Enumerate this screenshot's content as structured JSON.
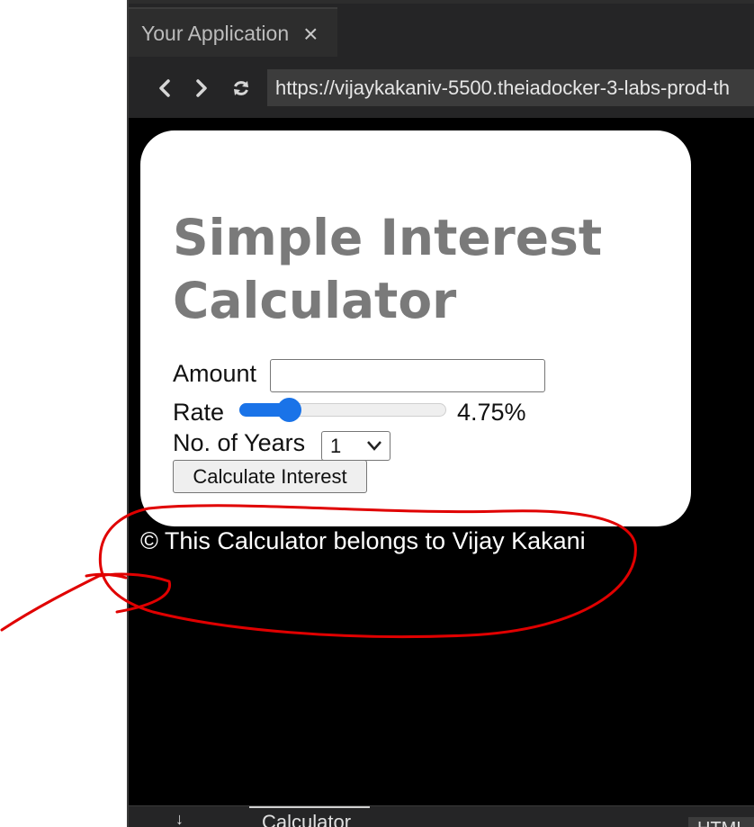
{
  "window": {
    "tab_title": "Your Application",
    "tab_close": "×",
    "url": "https://vijaykakaniv-5500.theiadocker-3-labs-prod-th"
  },
  "navbar": {
    "back_icon": "chevron-left-icon",
    "forward_icon": "chevron-right-icon",
    "reload_icon": "reload-icon"
  },
  "calculator": {
    "title": "Simple Interest Calculator",
    "amount_label": "Amount",
    "amount_value": "",
    "rate_label": "Rate",
    "rate_fraction": 0.24,
    "rate_value": "4.75%",
    "years_label": "No. of Years",
    "years_selected": "1",
    "button_label": "Calculate Interest"
  },
  "footer": {
    "text": "© This Calculator belongs to Vijay Kakani"
  },
  "statusbar": {
    "tab_label": "Calculator",
    "language": "HTML"
  },
  "colors": {
    "title": "#7a7a7a",
    "slider_accent": "#1a73e8",
    "annotation": "#e00000",
    "viewport_bg": "#000000"
  }
}
